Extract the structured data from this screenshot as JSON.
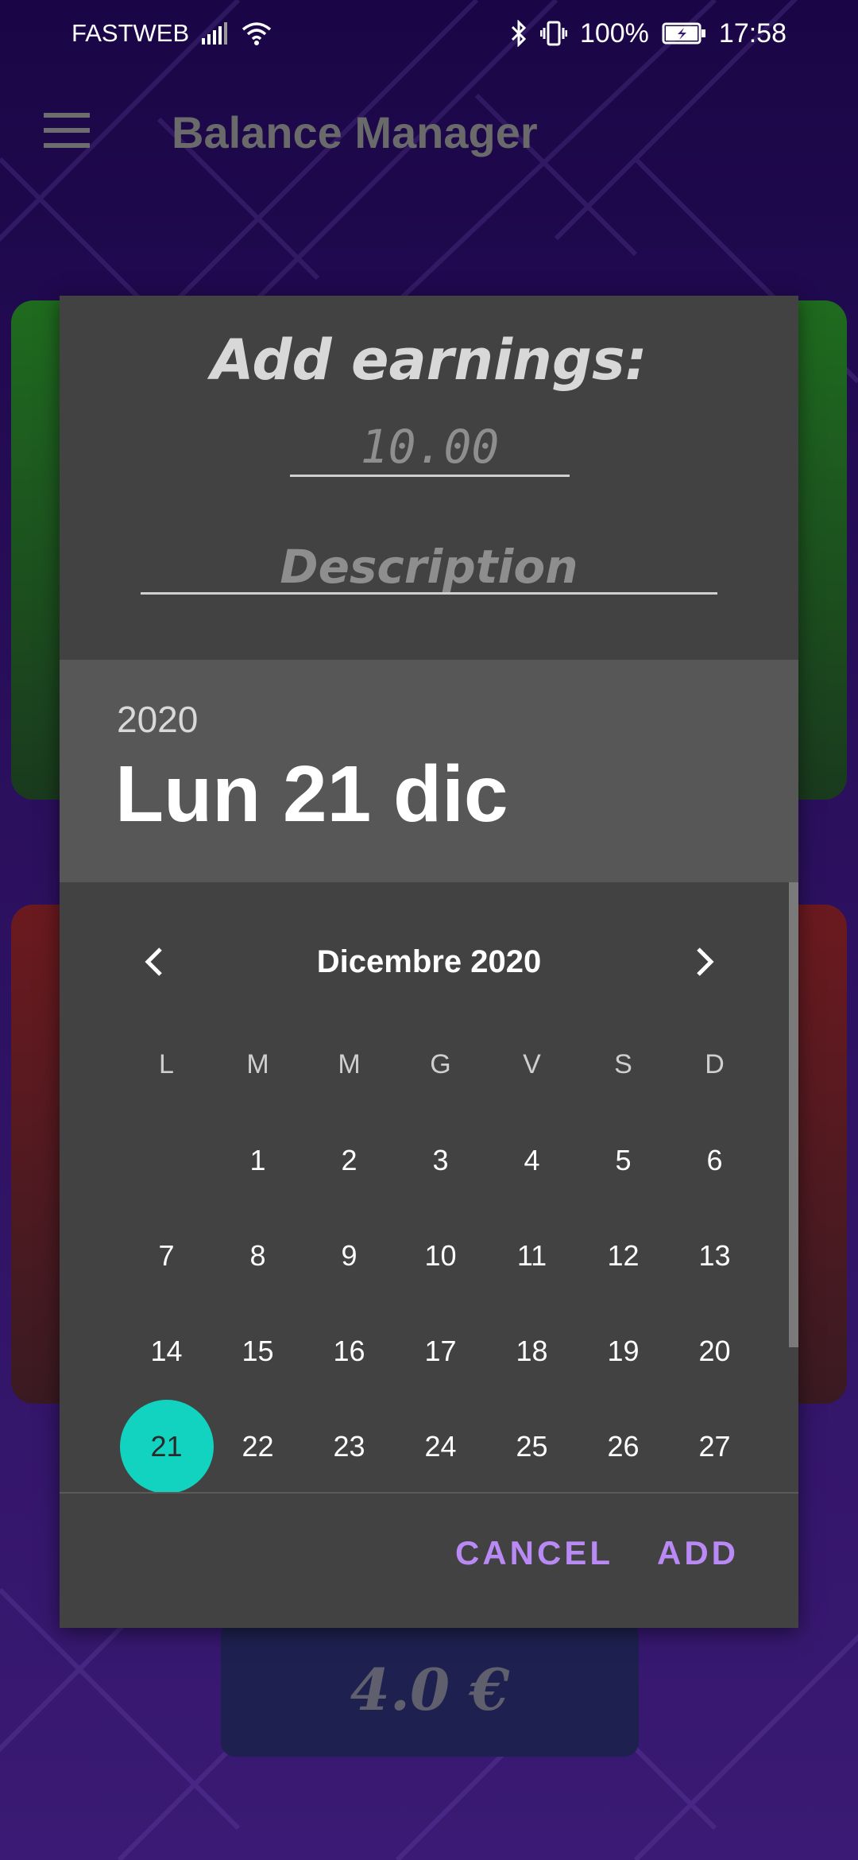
{
  "status_bar": {
    "carrier": "FASTWEB",
    "battery": "100%",
    "time": "17:58"
  },
  "app_bar": {
    "title": "Balance Manager"
  },
  "balance": {
    "value": "4.0 €"
  },
  "dialog": {
    "title": "Add earnings:",
    "amount_value": "10.00",
    "description_placeholder": "Description",
    "year": "2020",
    "selected_date": "Lun 21 dic",
    "month_label": "Dicembre 2020",
    "weekdays": [
      "L",
      "M",
      "M",
      "G",
      "V",
      "S",
      "D"
    ],
    "days": [
      "",
      "1",
      "2",
      "3",
      "4",
      "5",
      "6",
      "7",
      "8",
      "9",
      "10",
      "11",
      "12",
      "13",
      "14",
      "15",
      "16",
      "17",
      "18",
      "19",
      "20",
      "21",
      "22",
      "23",
      "24",
      "25",
      "26",
      "27"
    ],
    "selected_day": "21",
    "cancel_label": "CANCEL",
    "add_label": "ADD"
  },
  "colors": {
    "accent": "#b98af5",
    "selection": "#12d3bf",
    "dialog_bg": "#424242"
  }
}
